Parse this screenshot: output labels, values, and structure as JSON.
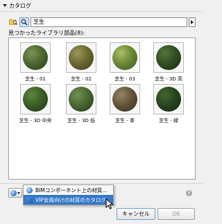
{
  "section": {
    "title": "カタログ"
  },
  "search": {
    "value": "芝生"
  },
  "results": {
    "label": "見つかったライブラリ部品(8):",
    "items": [
      {
        "label": "芝生 - 01",
        "color": "#4d6b2e",
        "shade": "#23361a",
        "hi": "#7f9a55"
      },
      {
        "label": "芝生 - 02",
        "color": "#6f6b2d",
        "shade": "#3a3817",
        "hi": "#a59f5a"
      },
      {
        "label": "芝生 - 03",
        "color": "#6f8f34",
        "shade": "#3b5419",
        "hi": "#b3cc66"
      },
      {
        "label": "芝生 - 3D 高",
        "color": "#2f4e1d",
        "shade": "#14250c",
        "hi": "#557a38"
      },
      {
        "label": "芝生 - 3D 中央",
        "color": "#3a5f22",
        "shade": "#1a2f0e",
        "hi": "#5f8a3b"
      },
      {
        "label": "芝生 - 3D 低",
        "color": "#496b2c",
        "shade": "#203516",
        "hi": "#75985a"
      },
      {
        "label": "芝生 - 茶",
        "color": "#67543a",
        "shade": "#33281a",
        "hi": "#9c8a66"
      },
      {
        "label": "芝生 - 緑",
        "color": "#24441a",
        "shade": "#0f2009",
        "hi": "#3f6a2c"
      }
    ]
  },
  "popup": {
    "items": [
      {
        "label": "BIMコンポーネント上の材質..."
      },
      {
        "label": "VIP会員向けの材質のカタログ..."
      }
    ]
  },
  "buttons": {
    "cancel": "キャンセル",
    "ok": "OK"
  },
  "info": {
    "glyph": "i"
  }
}
